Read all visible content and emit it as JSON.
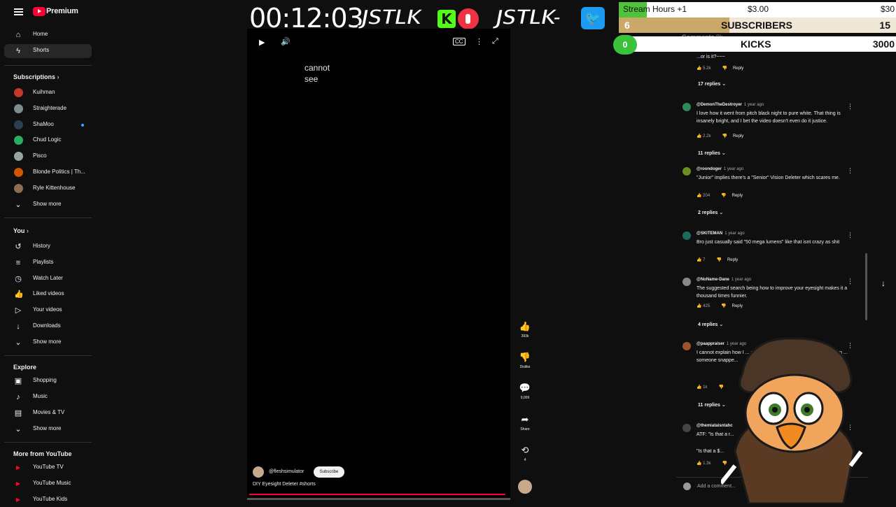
{
  "sidebar": {
    "brand": "Premium",
    "main": [
      {
        "label": "Home",
        "icon": "home-icon",
        "glyph": "⌂"
      },
      {
        "label": "Shorts",
        "icon": "shorts-icon",
        "glyph": "ϟ",
        "active": true
      }
    ],
    "subscriptions_title": "Subscriptions",
    "subscriptions": [
      {
        "label": "Kuihman",
        "color": "#c0392b"
      },
      {
        "label": "Straighterade",
        "color": "#7f8c8d"
      },
      {
        "label": "ShaMoo",
        "color": "#2c3e50",
        "live": true
      },
      {
        "label": "Chud Logic",
        "color": "#27ae60"
      },
      {
        "label": "Pisco",
        "color": "#95a5a6"
      },
      {
        "label": "Blonde Politics | Th...",
        "color": "#d35400"
      },
      {
        "label": "Ryle Kittenhouse",
        "color": "#8e6e53"
      }
    ],
    "show_more": "Show more",
    "you_title": "You",
    "you_items": [
      {
        "label": "History",
        "icon": "history-icon",
        "glyph": "↺"
      },
      {
        "label": "Playlists",
        "icon": "playlists-icon",
        "glyph": "≡"
      },
      {
        "label": "Watch Later",
        "icon": "clock-icon",
        "glyph": "◷"
      },
      {
        "label": "Liked videos",
        "icon": "thumbs-up-icon",
        "glyph": "👍"
      },
      {
        "label": "Your videos",
        "icon": "video-icon",
        "glyph": "▷"
      },
      {
        "label": "Downloads",
        "icon": "download-icon",
        "glyph": "↓"
      }
    ],
    "explore_title": "Explore",
    "explore_items": [
      {
        "label": "Shopping",
        "icon": "shopping-bag-icon",
        "glyph": "▣"
      },
      {
        "label": "Music",
        "icon": "music-icon",
        "glyph": "♪"
      },
      {
        "label": "Movies & TV",
        "icon": "film-icon",
        "glyph": "▤"
      }
    ],
    "more_title": "More from YouTube",
    "more_items": [
      {
        "label": "YouTube TV"
      },
      {
        "label": "YouTube Music"
      },
      {
        "label": "YouTube Kids"
      }
    ]
  },
  "player": {
    "text_line1": "cannot",
    "text_line2": "see",
    "channel": "@fleshsimulator",
    "subscribe": "Subscribe",
    "title": "DIY Eyesight Deleter #shorts",
    "progress": 0.99
  },
  "actions": {
    "likes": "393k",
    "dislike": "Dislike",
    "comments": "9,009",
    "share": "Share",
    "remix": "4"
  },
  "overlay": {
    "timer": "00:12:03",
    "jstlk1": "JSTLK",
    "jstlk2": "JSTLK",
    "stream_hours": "Stream Hours +1",
    "stream_mid": "$3.00",
    "stream_right": "$30",
    "stream_progress": 0.1,
    "subs_count": "6",
    "subs_label": "SUBSCRIBERS",
    "subs_goal": "15",
    "subs_progress": 0.4,
    "kicks_count": "0",
    "kicks_label": "KICKS",
    "kicks_goal": "3000",
    "colors": {
      "kick": "#53fc18",
      "twitter": "#1d9bf0"
    }
  },
  "comments": {
    "header": "Comments",
    "header_count": "9k",
    "items": [
      {
        "text": "...or is it?~~~",
        "likes": "5.2k",
        "reply": "Reply",
        "replies": "17 replies",
        "partial": true
      },
      {
        "author": "@DemonTheDestroyer",
        "time": "1 year ago",
        "text": "I love how it went from pitch black night to pure white. That thing is insanely bright, and I bet the video doesn't even do it justice.",
        "likes": "2.2k",
        "reply": "Reply",
        "replies": "11 replies",
        "color": "#2e8b57"
      },
      {
        "author": "@roondoger",
        "time": "1 year ago",
        "text": "\"Junior\" implies there's a \"Senior\" Vision Deleter which scares me.",
        "likes": "204",
        "reply": "Reply",
        "replies": "2 replies",
        "color": "#6b8e23"
      },
      {
        "author": "@SKITEMAN",
        "time": "1 year ago",
        "text": "Bro just casually said \"50 mega lumens\" like that isnt crazy as shit",
        "likes": "7",
        "reply": "Reply",
        "color": "#1e6b5c"
      },
      {
        "author": "@NoName-Dane",
        "time": "1 year ago",
        "text": "The suggested search being how to improve your eyesight makes it a thousand times funnier.",
        "likes": "425",
        "reply": "Reply",
        "replies": "4 replies",
        "color": "#888888"
      },
      {
        "author": "@paappraiser",
        "time": "1 year ago",
        "text": "I cannot explain how I ... a vintage Vivitar flash ... put it on your arm ... someone snappe...",
        "likes": "1k",
        "replies": "11 replies",
        "color": "#a0522d"
      },
      {
        "author": "@themiataisntahc",
        "text": "ATF: \"Is that a r...",
        "text2": "\"Is that a $...",
        "likes": "1.3k",
        "color": "#444444"
      }
    ],
    "add_placeholder": "Add a comment..."
  }
}
